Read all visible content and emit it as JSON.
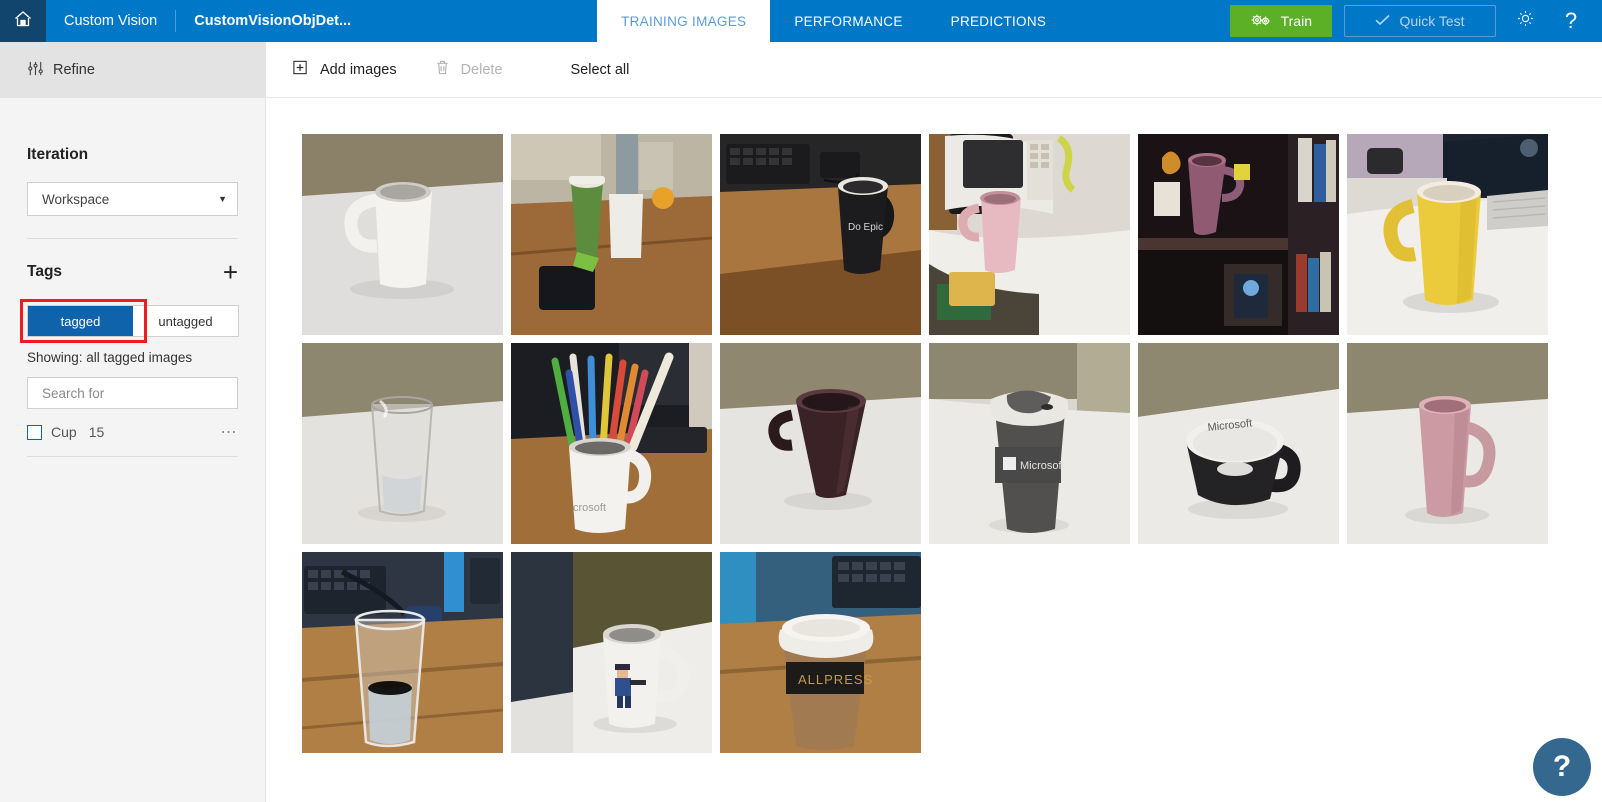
{
  "header": {
    "home_icon": "home-icon",
    "brand": "Custom Vision",
    "project_name": "CustomVisionObjDet...",
    "tabs": [
      {
        "label": "TRAINING IMAGES",
        "active": true
      },
      {
        "label": "PERFORMANCE",
        "active": false
      },
      {
        "label": "PREDICTIONS",
        "active": false
      }
    ],
    "train_button": "Train",
    "train_icon": "gears-icon",
    "train_color": "#5bb025",
    "quick_test_button": "Quick Test",
    "quick_test_icon": "check-icon",
    "settings_icon": "gear-icon",
    "help_icon": "question-mark-icon",
    "bar_color": "#0078c8"
  },
  "sidebar": {
    "refine_label": "Refine",
    "refine_icon": "sliders-icon",
    "iteration_title": "Iteration",
    "iteration_value": "Workspace",
    "iteration_caret": "chevron-down-icon",
    "tags_title": "Tags",
    "add_tag_icon": "plus-icon",
    "toggle": {
      "options": [
        "tagged",
        "untagged"
      ],
      "selected": "tagged",
      "selected_color": "#0f63ab",
      "highlight_color": "#ee1b20"
    },
    "showing_label": "Showing: all tagged images",
    "search_placeholder": "Search for",
    "search_value": "",
    "tags": [
      {
        "name": "Cup",
        "count": "15",
        "checked": false,
        "more_icon": "ellipsis-icon"
      }
    ]
  },
  "toolbar": {
    "add_images": "Add images",
    "add_images_icon": "add-image-icon",
    "delete": "Delete",
    "delete_icon": "trash-icon",
    "delete_disabled": true,
    "select_all": "Select all"
  },
  "gallery": {
    "count": 15,
    "images": [
      {
        "name": "white-mug-on-desk",
        "alt": "White ceramic mug on a light grey table"
      },
      {
        "name": "green-coffee-cup-and-white-mug",
        "alt": "Green takeaway cup beside a white mug on a wooden desk"
      },
      {
        "name": "black-do-epic-mug",
        "alt": "Black Microsoft mug on a wooden desk near a keyboard"
      },
      {
        "name": "pink-mug-by-microwave",
        "alt": "Pink mug on a white counter next to a microwave"
      },
      {
        "name": "purple-mug-on-shelf",
        "alt": "Purple mug on a dark bookshelf"
      },
      {
        "name": "yellow-mug-by-monitor",
        "alt": "Large yellow mug on a white desk by a monitor"
      },
      {
        "name": "empty-glass-on-table",
        "alt": "Empty drinking glass on a white table"
      },
      {
        "name": "pencil-holder-mug",
        "alt": "White Microsoft mug holding coloured pencils"
      },
      {
        "name": "dark-brown-mug",
        "alt": "Dark brown mug on a white table"
      },
      {
        "name": "microsoft-travel-tumbler",
        "alt": "Grey and white Microsoft travel tumbler"
      },
      {
        "name": "microsoft-black-teacup",
        "alt": "Black and white Microsoft teacup viewed from above"
      },
      {
        "name": "dusty-pink-tall-mug",
        "alt": "Tall dusty pink mug on a white table"
      },
      {
        "name": "water-glass-on-wooden-desk",
        "alt": "Glass of water on a wooden desk near a keyboard"
      },
      {
        "name": "character-print-mug",
        "alt": "White mug with a cartoon character print"
      },
      {
        "name": "takeaway-cup-with-lid",
        "alt": "Brown takeaway cup with a white lid on a wooden desk"
      }
    ]
  },
  "fab": {
    "label": "?",
    "icon": "help-icon",
    "color": "#35688f"
  }
}
